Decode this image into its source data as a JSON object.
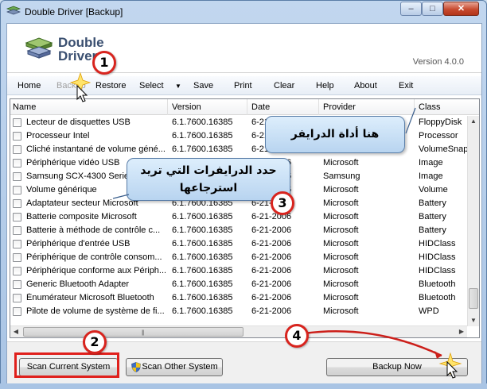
{
  "window": {
    "title": "Double Driver [Backup]",
    "controls": {
      "minimize": "–",
      "maximize": "□",
      "close": "✕"
    }
  },
  "banner": {
    "logo_line1": "Double",
    "logo_line2": "Driver",
    "version": "Version 4.0.0"
  },
  "menu": {
    "home": "Home",
    "backup": "Backup",
    "restore": "Restore",
    "select": "Select",
    "select_arrow": "▼",
    "save": "Save",
    "print": "Print",
    "clear": "Clear",
    "help": "Help",
    "about": "About",
    "exit": "Exit"
  },
  "table": {
    "columns": {
      "name": "Name",
      "version": "Version",
      "date": "Date",
      "provider": "Provider",
      "class": "Class"
    },
    "rows": [
      {
        "name": "Lecteur de disquettes USB",
        "version": "6.1.7600.16385",
        "date": "6-21-2006",
        "provider": "Microsoft",
        "class": "FloppyDisk"
      },
      {
        "name": "Processeur Intel",
        "version": "6.1.7600.16385",
        "date": "6-21-2006",
        "provider": "Microsoft",
        "class": "Processor"
      },
      {
        "name": "Cliché instantané de volume géné...",
        "version": "6.1.7600.16385",
        "date": "6-21-2006",
        "provider": "Microsoft",
        "class": "VolumeSnapshot"
      },
      {
        "name": "Périphérique vidéo USB",
        "version": "6.1.7600.16385",
        "date": "6-21-2006",
        "provider": "Microsoft",
        "class": "Image"
      },
      {
        "name": "Samsung SCX-4300 Series",
        "version": "6.1.7600.16385",
        "date": "6-21-2006",
        "provider": "Samsung",
        "class": "Image"
      },
      {
        "name": "Volume générique",
        "version": "6.1.7600.16385",
        "date": "6-21-2006",
        "provider": "Microsoft",
        "class": "Volume"
      },
      {
        "name": "Adaptateur secteur Microsoft",
        "version": "6.1.7600.16385",
        "date": "6-21-2006",
        "provider": "Microsoft",
        "class": "Battery"
      },
      {
        "name": "Batterie composite Microsoft",
        "version": "6.1.7600.16385",
        "date": "6-21-2006",
        "provider": "Microsoft",
        "class": "Battery"
      },
      {
        "name": "Batterie à méthode de contrôle c...",
        "version": "6.1.7600.16385",
        "date": "6-21-2006",
        "provider": "Microsoft",
        "class": "Battery"
      },
      {
        "name": "Périphérique d'entrée USB",
        "version": "6.1.7600.16385",
        "date": "6-21-2006",
        "provider": "Microsoft",
        "class": "HIDClass"
      },
      {
        "name": "Périphérique de contrôle consom...",
        "version": "6.1.7600.16385",
        "date": "6-21-2006",
        "provider": "Microsoft",
        "class": "HIDClass"
      },
      {
        "name": "Périphérique conforme aux Périph...",
        "version": "6.1.7600.16385",
        "date": "6-21-2006",
        "provider": "Microsoft",
        "class": "HIDClass"
      },
      {
        "name": "Generic Bluetooth Adapter",
        "version": "6.1.7600.16385",
        "date": "6-21-2006",
        "provider": "Microsoft",
        "class": "Bluetooth"
      },
      {
        "name": "Énumérateur Microsoft Bluetooth",
        "version": "6.1.7600.16385",
        "date": "6-21-2006",
        "provider": "Microsoft",
        "class": "Bluetooth"
      },
      {
        "name": "Pilote de volume de système de fi...",
        "version": "6.1.7600.16385",
        "date": "6-21-2006",
        "provider": "Microsoft",
        "class": "WPD"
      }
    ]
  },
  "buttons": {
    "scan_current": "Scan Current System",
    "scan_other": "Scan Other System",
    "backup_now": "Backup Now"
  },
  "annotations": {
    "step1": "1",
    "step2": "2",
    "step3": "3",
    "step4": "4",
    "callout_tool": "هنا أداة الدرايفر",
    "callout_select_line1": "حدد الدرايفرات التي تريد",
    "callout_select_line2": "استرجاعها",
    "accent_red": "#d8241e"
  }
}
